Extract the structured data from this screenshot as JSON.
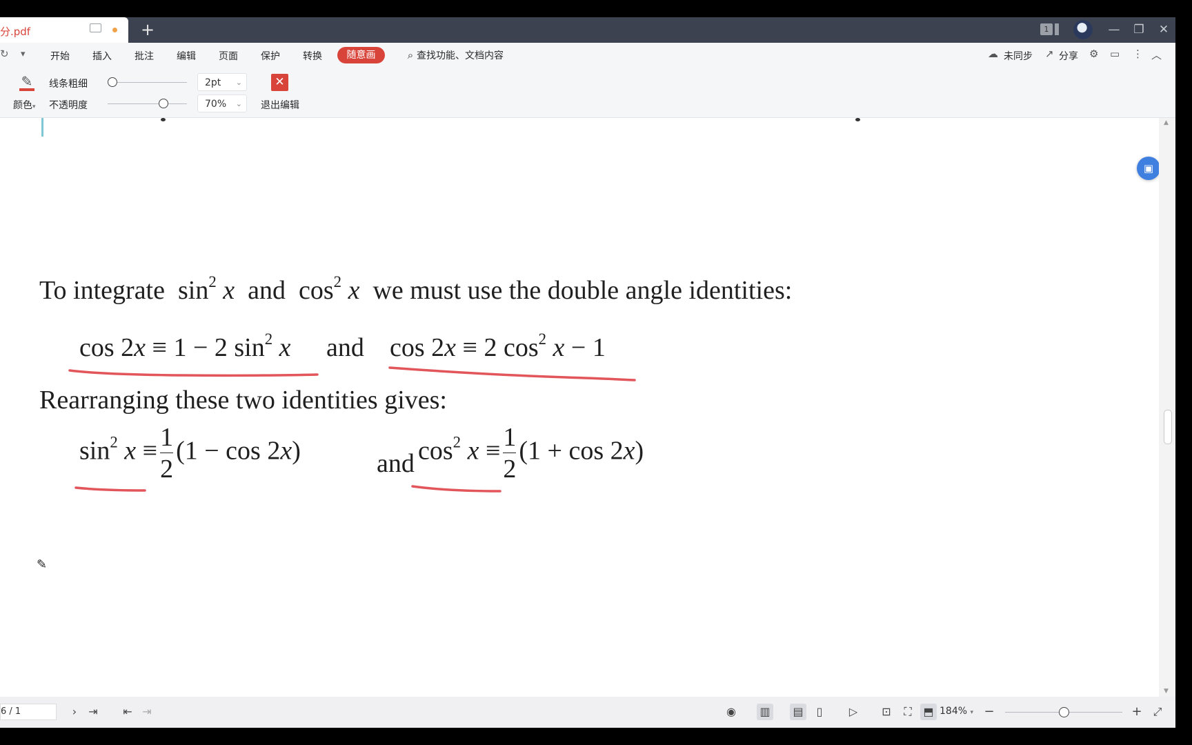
{
  "tab": {
    "title": "分.pdf",
    "new_tab_label": "+"
  },
  "window": {
    "window_count": "1",
    "minimize": "—",
    "restore": "❐",
    "close": "✕"
  },
  "menu": {
    "undo_icon": "↻",
    "dropdown_icon": "▾",
    "items": [
      "开始",
      "插入",
      "批注",
      "编辑",
      "页面",
      "保护",
      "转换",
      "随意画"
    ],
    "search_label": "查找功能、文档内容",
    "sync_label": "未同步",
    "share_label": "分享"
  },
  "drawbar": {
    "color_label": "颜色",
    "color_chevron": "▾",
    "thickness_label": "线条粗细",
    "thickness_value": "2pt",
    "thickness_level": 0.0,
    "opacity_label": "不透明度",
    "opacity_value": "70%",
    "opacity_level": 0.7,
    "exit_label": "退出编辑",
    "pen_color": "#d9443a"
  },
  "document": {
    "line1": {
      "prefix": "To integrate ",
      "sin": "sin",
      "sin_exp": "2",
      "x1": "x",
      "and": "and",
      "cos": "cos",
      "cos_exp": "2",
      "x2": "x",
      "suffix": "we must use the double angle identities:"
    },
    "identity1": {
      "lhs_fn": "cos 2",
      "lhs_var": "x",
      "rel": " ≡ 1 − 2 sin",
      "exp": "2",
      "var": "x"
    },
    "and_word": "and",
    "identity2": {
      "lhs_fn": "cos 2",
      "lhs_var": "x",
      "rel": " ≡ 2 cos",
      "exp": "2",
      "var": "x",
      "tail": " − 1"
    },
    "line3": "Rearranging these two identities gives:",
    "result1": {
      "fn": "sin",
      "exp": "2",
      "var": "x",
      "rel": "≡",
      "num": "1",
      "den": "2",
      "paren_open": "(1 − cos 2",
      "paren_var": "x",
      "paren_close": ")"
    },
    "result2": {
      "fn": "cos",
      "exp": "2",
      "var": "x",
      "rel": "≡",
      "num": "1",
      "den": "2",
      "paren_open": "(1 + cos 2",
      "paren_var": "x",
      "paren_close": ")"
    },
    "annotation_color": "#e2555a"
  },
  "statusbar": {
    "page_field": "6 / 1",
    "zoom_value": "184%",
    "zoom_chevron": "▾",
    "zoom_minus": "−",
    "zoom_plus": "+",
    "zoom_level": 0.5
  }
}
